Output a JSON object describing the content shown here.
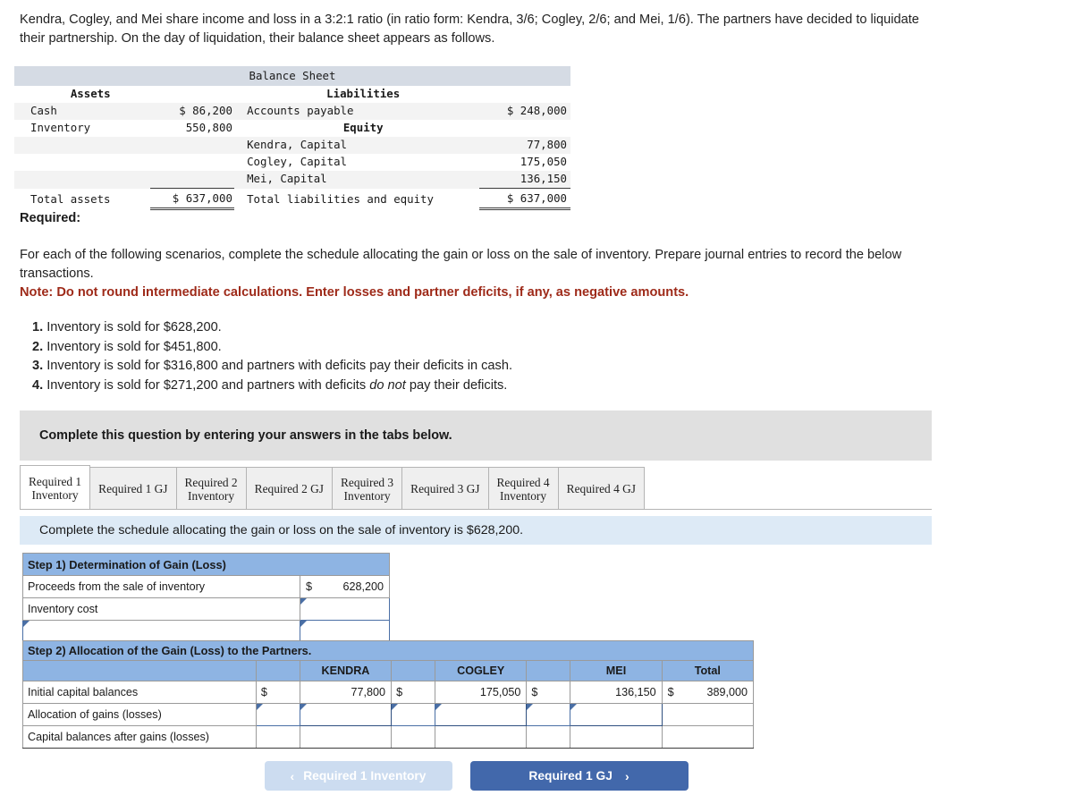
{
  "intro": "Kendra, Cogley, and Mei share income and loss in a 3:2:1 ratio (in ratio form: Kendra, 3/6; Cogley, 2/6; and Mei, 1/6). The partners have decided to liquidate their partnership. On the day of liquidation, their balance sheet appears as follows.",
  "balance_sheet": {
    "title": "Balance Sheet",
    "assets_header": "Assets",
    "liabilities_header": "Liabilities",
    "equity_header": "Equity",
    "rows": {
      "cash_label": "Cash",
      "cash_amount": "$ 86,200",
      "inventory_label": "Inventory",
      "inventory_amount": "550,800",
      "accounts_payable_label": "Accounts payable",
      "accounts_payable_amount": "$ 248,000",
      "kendra_label": "Kendra, Capital",
      "kendra_amount": "77,800",
      "cogley_label": "Cogley, Capital",
      "cogley_amount": "175,050",
      "mei_label": "Mei, Capital",
      "mei_amount": "136,150",
      "total_assets_label": "Total assets",
      "total_assets_amount": "$ 637,000",
      "total_le_label": "Total liabilities and equity",
      "total_le_amount": "$ 637,000"
    }
  },
  "required": {
    "heading": "Required:",
    "body": "For each of the following scenarios, complete the schedule allocating the gain or loss on the sale of inventory. Prepare journal entries to record the below transactions.",
    "note": "Note: Do not round intermediate calculations. Enter losses and partner deficits, if any, as negative amounts.",
    "scenarios": [
      {
        "num": "1.",
        "pre": "Inventory is sold for $628,200.",
        "em": "",
        "post": ""
      },
      {
        "num": "2.",
        "pre": "Inventory is sold for $451,800.",
        "em": "",
        "post": ""
      },
      {
        "num": "3.",
        "pre": "Inventory is sold for $316,800 and partners with deficits pay their deficits in cash.",
        "em": "",
        "post": ""
      },
      {
        "num": "4.",
        "pre": "Inventory is sold for $271,200 and partners with deficits ",
        "em": "do not",
        "post": " pay their deficits."
      }
    ]
  },
  "banner": {
    "text": "Complete this question by entering your answers in the tabs below."
  },
  "tabs": [
    {
      "label": "Required 1\nInventory",
      "active": true
    },
    {
      "label": "Required 1 GJ",
      "active": false
    },
    {
      "label": "Required 2\nInventory",
      "active": false
    },
    {
      "label": "Required 2 GJ",
      "active": false
    },
    {
      "label": "Required 3\nInventory",
      "active": false
    },
    {
      "label": "Required 3 GJ",
      "active": false
    },
    {
      "label": "Required 4\nInventory",
      "active": false
    },
    {
      "label": "Required 4 GJ",
      "active": false
    }
  ],
  "instruction": "Complete the schedule allocating the gain or loss on the sale of inventory is $628,200.",
  "step1": {
    "header": "Step 1) Determination of Gain (Loss)",
    "rows": [
      {
        "label": "Proceeds from the sale of inventory",
        "dollar": "$",
        "value": "628,200",
        "input_label": false,
        "input_value": false
      },
      {
        "label": "Inventory cost",
        "dollar": "",
        "value": "",
        "input_label": false,
        "input_value": true
      },
      {
        "label": "",
        "dollar": "",
        "value": "",
        "input_label": true,
        "input_value": true
      }
    ]
  },
  "step2": {
    "header": "Step 2) Allocation of the Gain (Loss) to the Partners.",
    "columns": [
      "",
      "",
      "KENDRA",
      "",
      "COGLEY",
      "",
      "MEI",
      "Total"
    ],
    "rows": [
      {
        "label": "Initial capital balances",
        "kendra_sign": "$",
        "kendra": "77,800",
        "cogley_sign": "$",
        "cogley": "175,050",
        "mei_sign": "$",
        "mei": "136,150",
        "total_sign": "$",
        "total": "389,000",
        "inputs": false,
        "underline": false
      },
      {
        "label": "Allocation of gains (losses)",
        "kendra_sign": "",
        "kendra": "",
        "cogley_sign": "",
        "cogley": "",
        "mei_sign": "",
        "mei": "",
        "total_sign": "",
        "total": "",
        "inputs": true,
        "underline": false
      },
      {
        "label": "Capital balances after gains (losses)",
        "kendra_sign": "",
        "kendra": "",
        "cogley_sign": "",
        "cogley": "",
        "mei_sign": "",
        "mei": "",
        "total_sign": "",
        "total": "",
        "inputs": false,
        "underline": true
      }
    ]
  },
  "nav": {
    "prev_label": "Required 1 Inventory",
    "prev_chevron": "‹",
    "next_label": "Required 1 GJ",
    "next_chevron": "›"
  }
}
